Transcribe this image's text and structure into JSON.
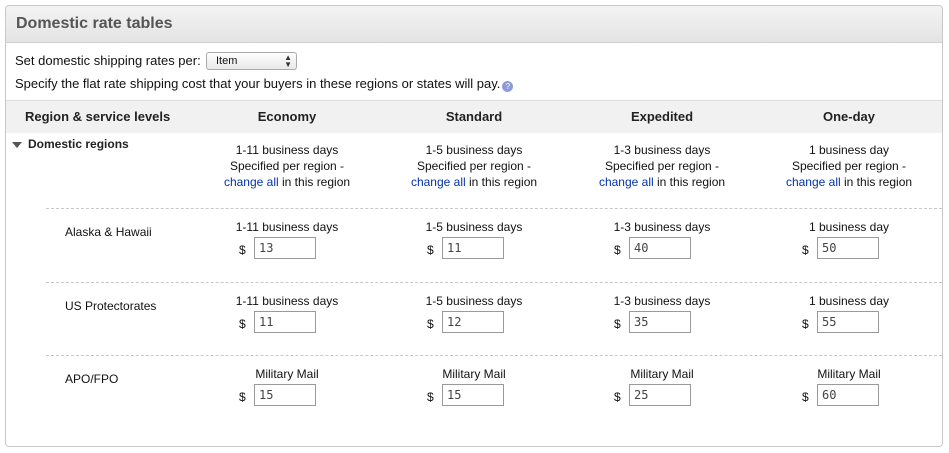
{
  "panel": {
    "title": "Domestic rate tables"
  },
  "rates_per": {
    "label": "Set domestic shipping rates per:",
    "selected": "Item"
  },
  "specify_text": "Specify the flat rate shipping cost that your buyers in these regions or states will pay.",
  "headers": {
    "region": "Region & service levels",
    "cols": [
      "Economy",
      "Standard",
      "Expedited",
      "One-day"
    ]
  },
  "domestic": {
    "label": "Domestic regions",
    "cols": [
      {
        "days": "1-11 business days",
        "note": "Specified per region -",
        "link": "change all",
        "suffix": " in this region"
      },
      {
        "days": "1-5 business days",
        "note": "Specified per region -",
        "link": "change all",
        "suffix": " in this region"
      },
      {
        "days": "1-3 business days",
        "note": "Specified per region -",
        "link": "change all",
        "suffix": " in this region"
      },
      {
        "days": "1 business day",
        "note": "Specified per region -",
        "link": "change all",
        "suffix": " in this region"
      }
    ]
  },
  "rows": [
    {
      "label": "Alaska & Hawaii",
      "cells": [
        {
          "days": "1-11 business days",
          "currency": "$",
          "value": "13"
        },
        {
          "days": "1-5 business days",
          "currency": "$",
          "value": "11"
        },
        {
          "days": "1-3 business days",
          "currency": "$",
          "value": "40"
        },
        {
          "days": "1 business day",
          "currency": "$",
          "value": "50"
        }
      ]
    },
    {
      "label": "US Protectorates",
      "cells": [
        {
          "days": "1-11 business days",
          "currency": "$",
          "value": "11"
        },
        {
          "days": "1-5 business days",
          "currency": "$",
          "value": "12"
        },
        {
          "days": "1-3 business days",
          "currency": "$",
          "value": "35"
        },
        {
          "days": "1 business day",
          "currency": "$",
          "value": "55"
        }
      ]
    },
    {
      "label": "APO/FPO",
      "cells": [
        {
          "days": "Military Mail",
          "currency": "$",
          "value": "15"
        },
        {
          "days": "Military Mail",
          "currency": "$",
          "value": "15"
        },
        {
          "days": "Military Mail",
          "currency": "$",
          "value": "25"
        },
        {
          "days": "Military Mail",
          "currency": "$",
          "value": "60"
        }
      ]
    }
  ]
}
